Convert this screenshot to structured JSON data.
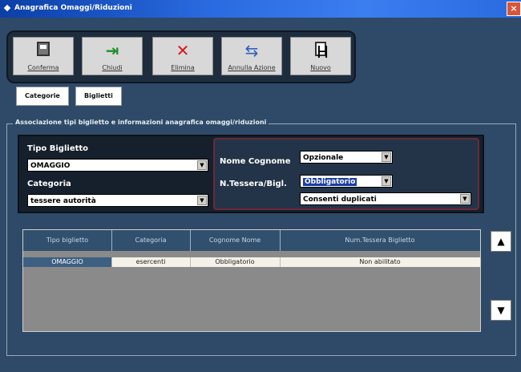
{
  "window": {
    "title": "Anagrafica Omaggi/Riduzioni"
  },
  "toolbar": {
    "buttons": [
      {
        "label": "Conferma",
        "icon": "save-icon"
      },
      {
        "label": "Chiudi",
        "icon": "exit-icon"
      },
      {
        "label": "Elimina",
        "icon": "delete-icon"
      },
      {
        "label": "Annulla Azione",
        "icon": "undo-icon"
      },
      {
        "label": "Nuovo",
        "icon": "new-document-icon"
      }
    ]
  },
  "tabs": [
    {
      "label": "Categorie"
    },
    {
      "label": "Biglietti"
    }
  ],
  "group": {
    "title": "Associazione tipi biglietto e informazioni anagrafica omaggi/riduzioni"
  },
  "form": {
    "tipo_biglietto": {
      "label": "Tipo Biglietto",
      "value": "OMAGGIO"
    },
    "categoria": {
      "label": "Categoria",
      "value": "tessere autorità"
    },
    "nome_cognome": {
      "label": "Nome Cognome",
      "value": "Opzionale"
    },
    "tessera": {
      "label": "N.Tessera/Bigl.",
      "value": "Obbligatorio"
    },
    "commenti": {
      "value": "Consenti duplicati"
    }
  },
  "grid": {
    "headers": [
      "Tipo biglietto",
      "Categoria",
      "Cognome Nome",
      "Num.Tessera Biglietto"
    ],
    "rows": [
      [
        "OMAGGIO",
        "esercenti",
        "Obbligatorio",
        "Non abilitato"
      ]
    ]
  },
  "scroll": {
    "up": "▲",
    "down": "▼"
  },
  "colors": {
    "titlebar": "#2a6ae0",
    "background": "#2e4a68",
    "panel": "#16202c",
    "selection": "#1a3da0"
  }
}
